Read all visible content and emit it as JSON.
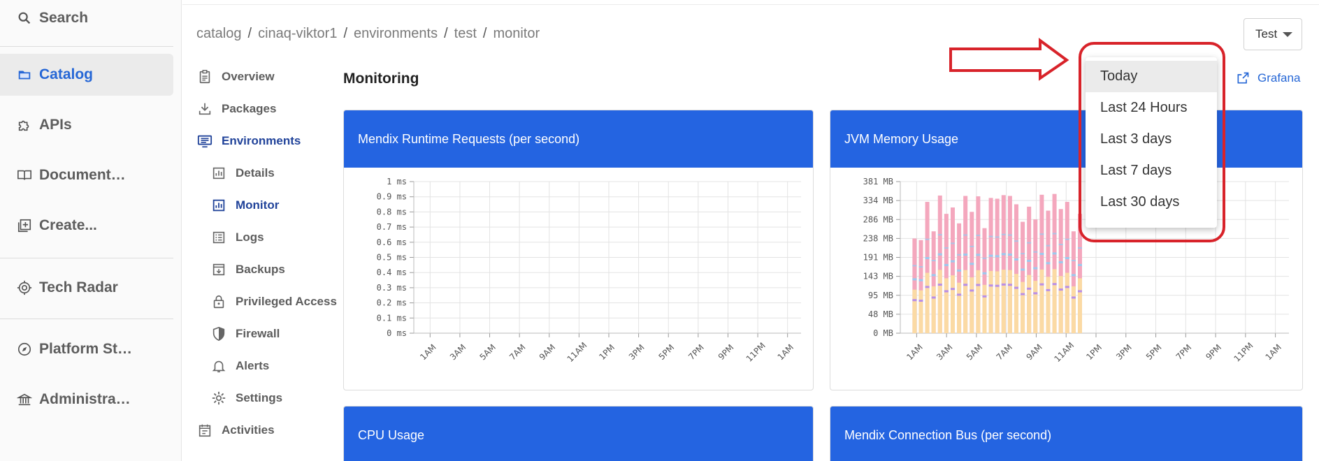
{
  "sidebar": {
    "items": [
      {
        "label": "Search",
        "icon": "search-icon"
      },
      {
        "label": "Catalog",
        "icon": "folder-icon"
      },
      {
        "label": "APIs",
        "icon": "puzzle-icon"
      },
      {
        "label": "Document…",
        "icon": "book-icon"
      },
      {
        "label": "Create...",
        "icon": "add-box-icon"
      },
      {
        "label": "Tech Radar",
        "icon": "radar-icon"
      },
      {
        "label": "Platform St…",
        "icon": "compass-icon"
      },
      {
        "label": "Administra…",
        "icon": "bank-icon"
      }
    ],
    "active": "Catalog"
  },
  "breadcrumb": [
    "catalog",
    "cinaq-viktor1",
    "environments",
    "test",
    "monitor"
  ],
  "env_select": {
    "value": "Test"
  },
  "subnav": {
    "items": [
      {
        "label": "Overview",
        "icon": "clipboard-icon"
      },
      {
        "label": "Packages",
        "icon": "download-icon"
      },
      {
        "label": "Environments",
        "icon": "monitor-icon"
      },
      {
        "label": "Details",
        "icon": "chart-box-icon"
      },
      {
        "label": "Monitor",
        "icon": "chart-box-icon"
      },
      {
        "label": "Logs",
        "icon": "list-icon"
      },
      {
        "label": "Backups",
        "icon": "archive-icon"
      },
      {
        "label": "Privileged Access",
        "icon": "lock-icon"
      },
      {
        "label": "Firewall",
        "icon": "shield-icon"
      },
      {
        "label": "Alerts",
        "icon": "bell-icon"
      },
      {
        "label": "Settings",
        "icon": "gear-icon"
      },
      {
        "label": "Activities",
        "icon": "calendar-icon"
      }
    ],
    "active": [
      "Environments",
      "Monitor"
    ]
  },
  "main": {
    "title": "Monitoring",
    "grafana_label": "Grafana"
  },
  "time_menu": {
    "options": [
      "Today",
      "Last 24 Hours",
      "Last 3 days",
      "Last 7 days",
      "Last 30 days"
    ],
    "selected": "Today"
  },
  "panels": [
    {
      "title": "Mendix Runtime Requests (per second)"
    },
    {
      "title": "JVM Memory Usage"
    },
    {
      "title": "CPU Usage"
    },
    {
      "title": "Mendix Connection Bus (per second)"
    }
  ],
  "colors": {
    "accent": "#2464e1",
    "annotation": "#d8232a",
    "bar_pink": "#f4a7bd",
    "bar_yellow": "#fbe3a0",
    "bar_blue": "#9cc8ee",
    "bar_purple": "#b98ee6"
  },
  "chart_data": [
    {
      "type": "line",
      "title": "Mendix Runtime Requests (per second)",
      "categories": [
        "1AM",
        "3AM",
        "5AM",
        "7AM",
        "9AM",
        "11AM",
        "1PM",
        "3PM",
        "5PM",
        "7PM",
        "9PM",
        "11PM",
        "1AM"
      ],
      "y_ticks": [
        "1 ms",
        "0.9 ms",
        "0.8 ms",
        "0.7 ms",
        "0.6 ms",
        "0.5 ms",
        "0.4 ms",
        "0.3 ms",
        "0.2 ms",
        "0.1 ms",
        "0 ms"
      ],
      "ylim": [
        0,
        1
      ],
      "series": [],
      "grid": true
    },
    {
      "type": "bar",
      "title": "JVM Memory Usage",
      "categories": [
        "1AM",
        "3AM",
        "5AM",
        "7AM",
        "9AM",
        "11AM",
        "1PM",
        "3PM",
        "5PM",
        "7PM",
        "9PM",
        "11PM",
        "1AM"
      ],
      "y_ticks": [
        "381 MB",
        "334 MB",
        "286 MB",
        "238 MB",
        "191 MB",
        "143 MB",
        "95 MB",
        "48 MB",
        "0 MB"
      ],
      "ylim": [
        0,
        381
      ],
      "bar_totals_mb": [
        238,
        234,
        330,
        256,
        346,
        300,
        316,
        276,
        345,
        305,
        344,
        264,
        340,
        338,
        347,
        345,
        324,
        280,
        318,
        286,
        348,
        308,
        350,
        312,
        330,
        256,
        300
      ],
      "grid": true
    }
  ]
}
